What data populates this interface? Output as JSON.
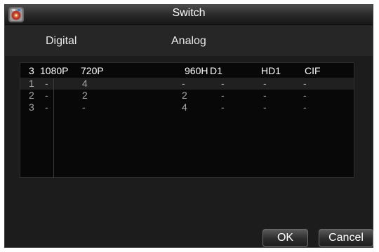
{
  "window": {
    "title": "Switch"
  },
  "header": {
    "digital_label": "Digital",
    "analog_label": "Analog"
  },
  "table": {
    "columns": [
      "3",
      "1080P",
      "720P",
      "960H",
      "D1",
      "HD1",
      "CIF"
    ],
    "rows": [
      [
        "1",
        "-",
        "4",
        "-",
        "-",
        "-",
        "-"
      ],
      [
        "2",
        "-",
        "2",
        "2",
        "-",
        "-",
        "-"
      ],
      [
        "3",
        "-",
        "-",
        "4",
        "-",
        "-",
        "-"
      ]
    ]
  },
  "buttons": {
    "ok_label": "OK",
    "cancel_label": "Cancel"
  },
  "colors": {
    "background": "#1c1c1c",
    "text": "#ffffff",
    "muted_text": "#a8a8a8"
  },
  "icons": {
    "app": "camera-icon"
  }
}
